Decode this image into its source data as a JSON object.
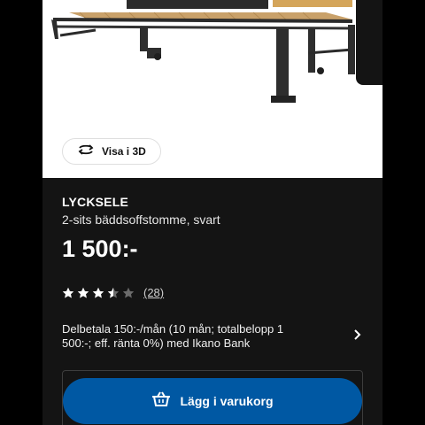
{
  "colors": {
    "background": "#141414",
    "image_background": "#ffffff",
    "accent_blue": "#0058a3",
    "star": "#ffffff",
    "star_empty": "#6b6b6b"
  },
  "gallery": {
    "view_3d": {
      "label": "Visa i 3D",
      "icon": "rotate-3d-icon"
    }
  },
  "product": {
    "name": "LYCKSELE",
    "description": "2-sits bäddsoffstomme, svart",
    "price": "1 500:-"
  },
  "rating": {
    "value": 3.5,
    "max": 5,
    "count": "(28)"
  },
  "financing": {
    "text": "Delbetala 150:-/mån (10 mån; totalbelopp 1 500:-; eff. ränta 0%) med Ikano Bank",
    "icon": "chevron-right-icon"
  },
  "cart": {
    "label": "Lägg i varukorg",
    "icon": "shopping-basket-icon"
  }
}
